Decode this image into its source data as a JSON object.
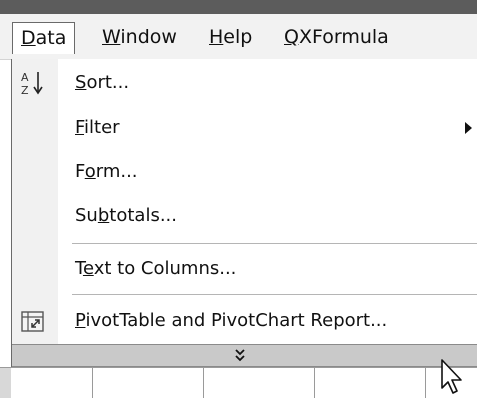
{
  "menubar": {
    "items": [
      {
        "label": "Data",
        "underline": "D",
        "rest": "ata"
      },
      {
        "label": "Window",
        "underline": "W",
        "rest": "indow"
      },
      {
        "label": "Help",
        "underline": "H",
        "rest": "elp"
      },
      {
        "label": "QXFormula",
        "underline": "Q",
        "rest": "XFormula"
      }
    ]
  },
  "menu": {
    "sort": {
      "pre": "",
      "ul": "S",
      "post": "ort..."
    },
    "filter": {
      "pre": "",
      "ul": "F",
      "post": "ilter"
    },
    "form": {
      "pre": "F",
      "ul": "o",
      "post": "rm..."
    },
    "subtotals": {
      "pre": "Su",
      "ul": "b",
      "post": "totals..."
    },
    "text_to_columns": {
      "pre": "T",
      "ul": "e",
      "post": "xt to Columns..."
    },
    "pivot": {
      "pre": "",
      "ul": "P",
      "post": "ivotTable and PivotChart Report..."
    }
  },
  "icons": {
    "sort": "sort-ascending-icon",
    "pivot": "pivottable-icon",
    "expand": "double-chevron-down-icon",
    "submenu": "submenu-arrow-icon",
    "cursor": "mouse-pointer-icon"
  }
}
